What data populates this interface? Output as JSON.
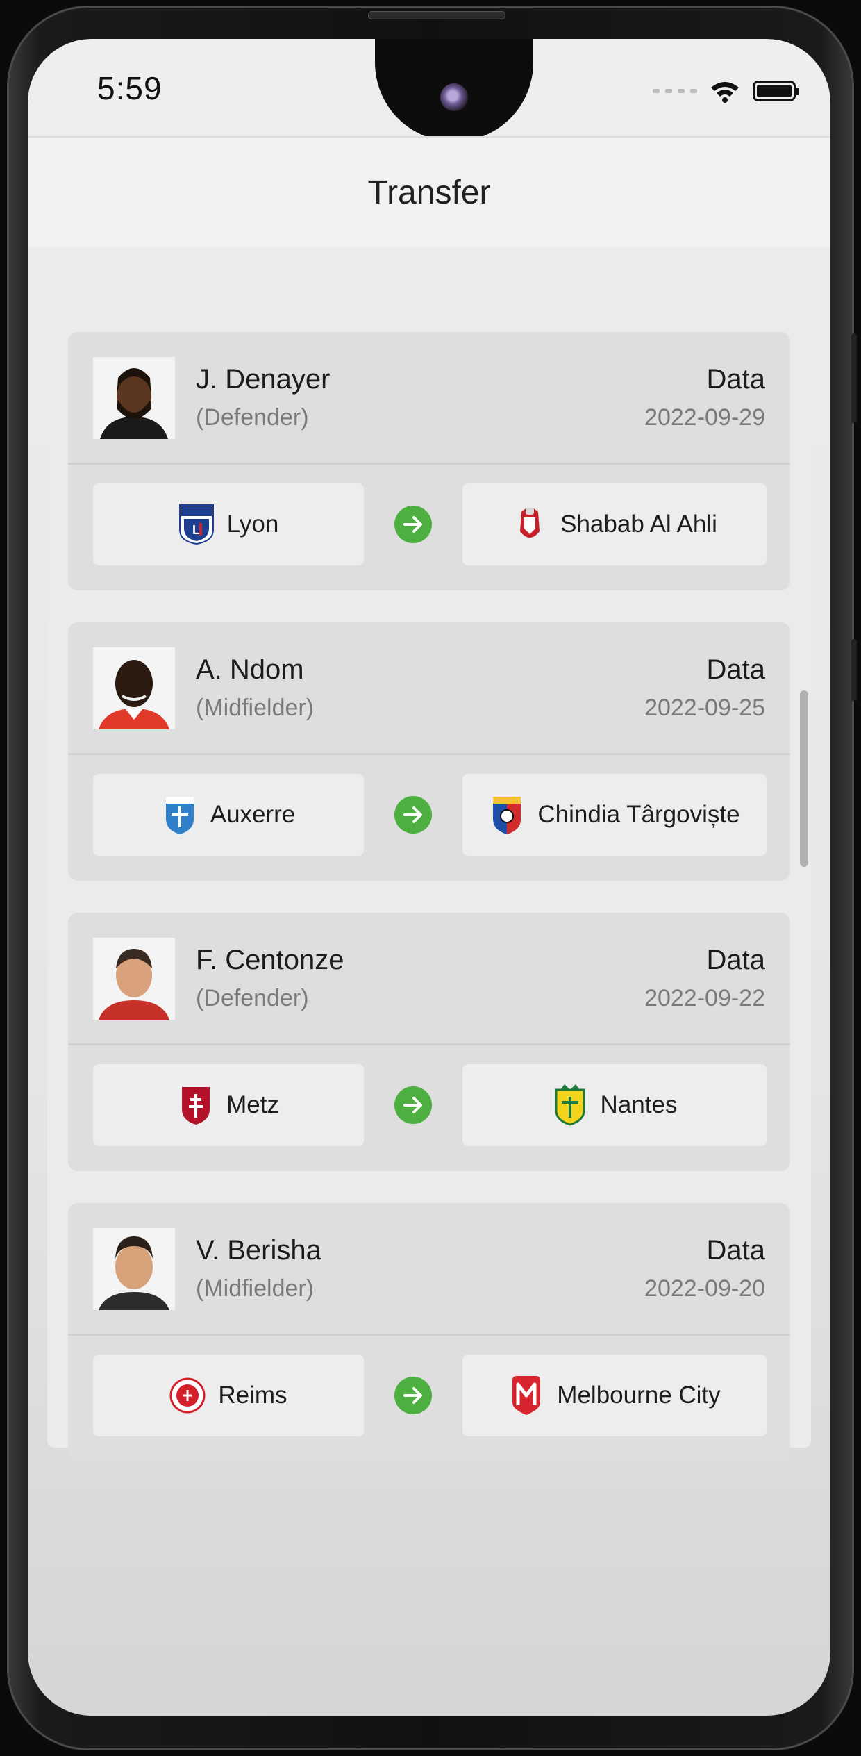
{
  "status_bar": {
    "time": "5:59"
  },
  "header": {
    "title": "Transfer"
  },
  "transfers": [
    {
      "name": "J. Denayer",
      "position": "(Defender)",
      "date_label": "Data",
      "date": "2022-09-29",
      "from": "Lyon",
      "to": "Shabab Al Ahli"
    },
    {
      "name": "A. Ndom",
      "position": "(Midfielder)",
      "date_label": "Data",
      "date": "2022-09-25",
      "from": "Auxerre",
      "to": "Chindia Târgoviște"
    },
    {
      "name": "F. Centonze",
      "position": "(Defender)",
      "date_label": "Data",
      "date": "2022-09-22",
      "from": "Metz",
      "to": "Nantes"
    },
    {
      "name": "V. Berisha",
      "position": "(Midfielder)",
      "date_label": "Data",
      "date": "2022-09-20",
      "from": "Reims",
      "to": "Melbourne City"
    }
  ],
  "icons": {
    "signal": "signal-dots-icon",
    "wifi": "wifi-icon",
    "battery": "battery-icon",
    "arrow": "arrow-right-icon"
  },
  "colors": {
    "arrow_badge": "#4caf3f",
    "card_background": "#dedede",
    "club_box": "#ededed"
  }
}
